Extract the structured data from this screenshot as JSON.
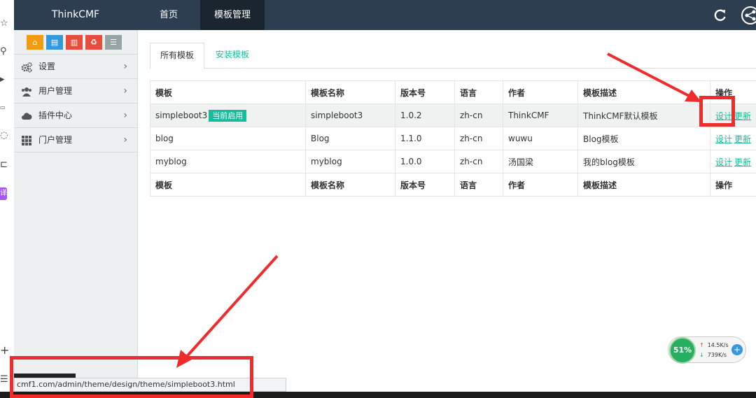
{
  "navbar": {
    "brand": "ThinkCMF",
    "items": [
      "首页",
      "模板管理"
    ]
  },
  "sidebar": {
    "items": [
      {
        "label": "设置",
        "icon": "gears-icon"
      },
      {
        "label": "用户管理",
        "icon": "users-icon"
      },
      {
        "label": "插件中心",
        "icon": "cloud-icon"
      },
      {
        "label": "门户管理",
        "icon": "grid-icon"
      }
    ],
    "shortcut_icons": [
      "home-icon",
      "file-icon",
      "trash-icon",
      "recycle-icon",
      "list-icon"
    ]
  },
  "tabs": {
    "all": "所有模板",
    "install": "安装模板"
  },
  "table": {
    "headers": [
      "模板",
      "模板名称",
      "版本号",
      "语言",
      "作者",
      "模板描述",
      "操作"
    ],
    "rows": [
      {
        "theme": "simpleboot3",
        "badge": "当前启用",
        "name": "simpleboot3",
        "version": "1.0.2",
        "lang": "zh-cn",
        "author": "ThinkCMF",
        "desc": "ThinkCMF默认模板"
      },
      {
        "theme": "blog",
        "badge": "",
        "name": "Blog",
        "version": "1.1.0",
        "lang": "zh-cn",
        "author": "wuwu",
        "desc": "Blog模板"
      },
      {
        "theme": "myblog",
        "badge": "",
        "name": "myblog",
        "version": "1.0.0",
        "lang": "zh-cn",
        "author": "汤国梁",
        "desc": "我的blog模板"
      }
    ],
    "actions": {
      "design": "设计",
      "update": "更新"
    }
  },
  "status_url": "cmf1.com/admin/theme/design/theme/simpleboot3.html",
  "speed_widget": {
    "percent": "51%",
    "upload": "14.5K/s",
    "download": "739K/s"
  },
  "browser_strip": {
    "badge": "译"
  },
  "colors": {
    "navbar": "#2c3e50",
    "accent": "#18bc9c",
    "annotation": "#ef2b2b"
  }
}
